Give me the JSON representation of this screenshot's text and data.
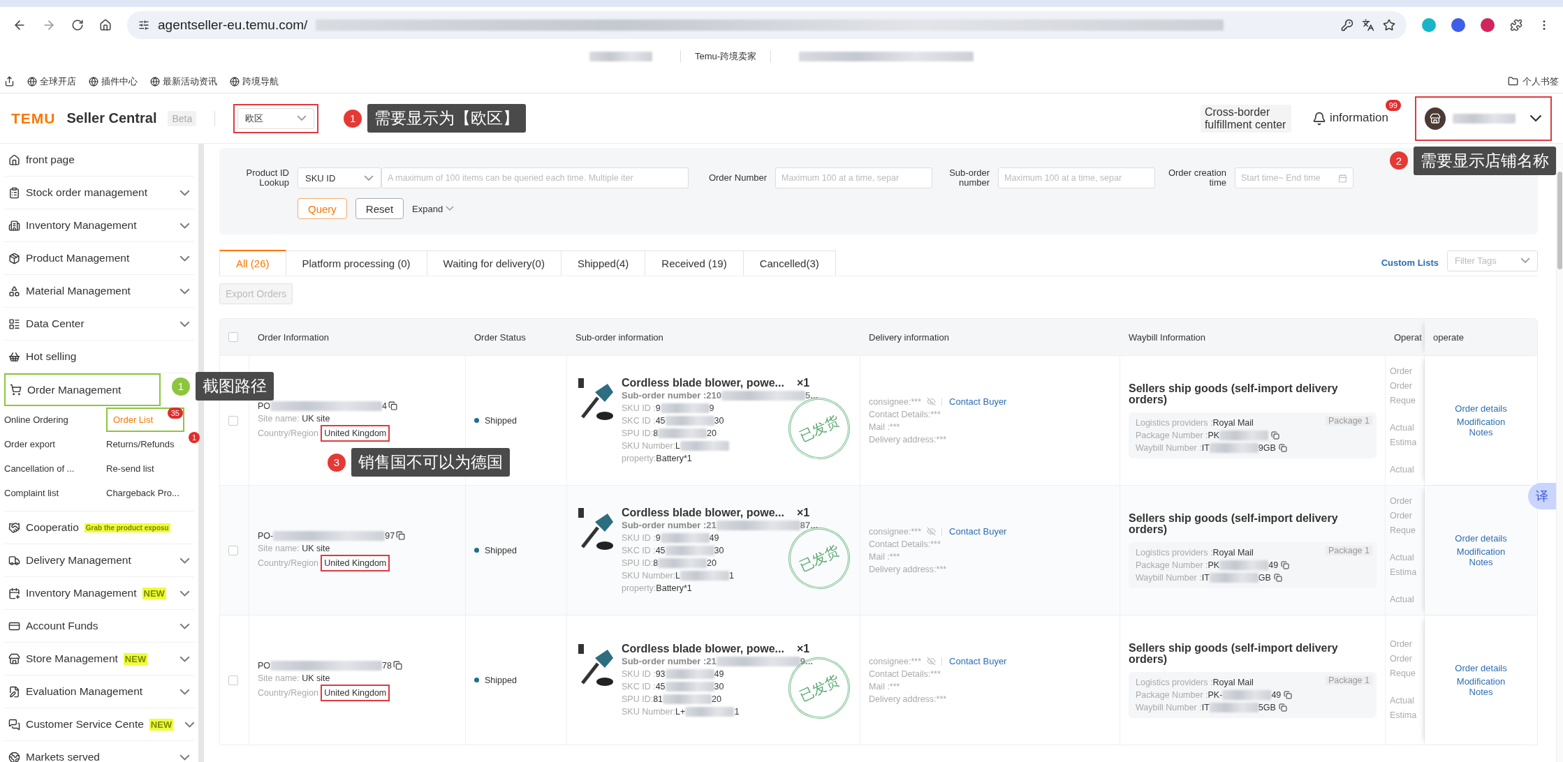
{
  "browser": {
    "url": "agentseller-eu.temu.com/",
    "tab_title": "Temu-跨境卖家",
    "bookmarks": [
      "全球开店",
      "插件中心",
      "最新活动资讯",
      "跨境导航"
    ],
    "bookmark_folder": "个人书签"
  },
  "header": {
    "brand": "TEMU",
    "product": "Seller Central",
    "beta": "Beta",
    "region": {
      "value": "欧区",
      "color": "#e0393e",
      "callout": {
        "number": "1",
        "text": "需要显示为【欧区】",
        "color": "#e53935"
      }
    },
    "fulfillment": "Cross-border fulfillment center",
    "information": {
      "label": "information",
      "badge": "99"
    },
    "account": {
      "color": "#e0393e",
      "callout": {
        "number": "2",
        "text": "需要显示店铺名称",
        "color": "#e53935"
      }
    }
  },
  "sidebar": {
    "items": [
      {
        "label": "front page",
        "kind": "link"
      },
      {
        "label": "Stock order management",
        "kind": "group"
      },
      {
        "label": "Inventory Management",
        "kind": "group"
      },
      {
        "label": "Product Management",
        "kind": "group"
      },
      {
        "label": "Material Management",
        "kind": "group"
      },
      {
        "label": "Data Center",
        "kind": "group"
      },
      {
        "label": "Hot selling",
        "kind": "link"
      },
      {
        "label": "Order Management",
        "kind": "open",
        "color": "#8cc63f",
        "callout": {
          "number": "1",
          "text": "截图路径",
          "color": "#8cc63f"
        },
        "children": [
          {
            "label": "Online Ordering",
            "selected": false
          },
          {
            "label": "Order List",
            "selected": true,
            "badge": "35",
            "color": "#8cc63f"
          },
          {
            "label": "Order export",
            "selected": false
          },
          {
            "label": "Returns/Refunds",
            "selected": false,
            "badge": "1"
          },
          {
            "label": "Cancellation of ...",
            "selected": false
          },
          {
            "label": "Re-send list",
            "selected": false
          },
          {
            "label": "Complaint list",
            "selected": false
          },
          {
            "label": "Chargeback Pro...",
            "selected": false
          }
        ]
      },
      {
        "label": "Cooperatio",
        "kind": "promo",
        "tag": "Grab the product exposu"
      },
      {
        "label": "Delivery Management",
        "kind": "group"
      },
      {
        "label": "Inventory Management",
        "kind": "group",
        "tag": "NEW"
      },
      {
        "label": "Account Funds",
        "kind": "group"
      },
      {
        "label": "Store Management",
        "kind": "group",
        "tag": "NEW"
      },
      {
        "label": "Evaluation Management",
        "kind": "group"
      },
      {
        "label": "Customer Service Cente",
        "kind": "group",
        "tag": "NEW"
      },
      {
        "label": "Markets served",
        "kind": "group"
      }
    ]
  },
  "filters": {
    "lookup_label": "Product ID Lookup",
    "lookup_type": "SKU ID",
    "lookup_placeholder": "A maximum of 100 items can be queried each time. Multiple iter",
    "order_label": "Order Number",
    "order_placeholder": "Maximum 100 at a time, separ",
    "suborder_label": "Sub-order number",
    "suborder_placeholder": "Maximum 100 at a time, separ",
    "time_label": "Order creation time",
    "time_placeholder": "Start time~ End time",
    "query": "Query",
    "reset": "Reset",
    "expand": "Expand"
  },
  "tabs": [
    {
      "label": "All (26)",
      "selected": true
    },
    {
      "label": "Platform processing (0)",
      "selected": false
    },
    {
      "label": "Waiting for delivery(0)",
      "selected": false
    },
    {
      "label": "Shipped(4)",
      "selected": false
    },
    {
      "label": "Received (19)",
      "selected": false
    },
    {
      "label": "Cancelled(3)",
      "selected": false
    }
  ],
  "custom_lists": "Custom Lists",
  "filter_tags": "Filter Tags",
  "export": {
    "label": "Export Orders",
    "disabled": true
  },
  "table": {
    "checked": false,
    "columns": [
      "Order Information",
      "Order Status",
      "Sub-order information",
      "Delivery information",
      "Waybill Information",
      "Operat",
      "operate"
    ],
    "rows": [
      {
        "checked": false,
        "order_no": {
          "head": "PO",
          "tail": "4"
        },
        "site_label": "Site name:",
        "site": "UK site",
        "country_label": "Country/Region",
        "country": {
          "name": "United Kingdom",
          "color": "#e0393e"
        },
        "callout": {
          "number": "3",
          "text": "销售国不可以为德国",
          "color": "#e53935"
        },
        "status": "Shipped",
        "product": {
          "title": "Cordless blade blower, powe...",
          "qty": "×1",
          "sub_order": {
            "label": "Sub-order number :",
            "head": "210",
            "tail": "5..."
          },
          "fields": [
            {
              "label": "SKU ID :",
              "head": "9",
              "tail": "9"
            },
            {
              "label": "SKC ID :",
              "head": "45",
              "tail": "30"
            },
            {
              "label": "SPU ID:",
              "head": "8",
              "tail": "20"
            },
            {
              "label": "SKU Number:",
              "head": "L"
            }
          ],
          "property_label": "property:",
          "property": "Battery*1",
          "stamp": "已发货"
        },
        "delivery": {
          "consignee": "consignee:***",
          "contact": "Contact Buyer",
          "details": [
            "Contact Details:***",
            "Mail :***",
            "Delivery address:***"
          ]
        },
        "waybill": {
          "title": "Sellers ship goods (self-import delivery orders)",
          "provider_label": "Logistics providers :",
          "provider": "Royal Mail",
          "package": "Package 1",
          "package_no": {
            "label": "Package Number :",
            "head": "PK"
          },
          "waybill_no": {
            "label": "Waybill Number :",
            "head": "IT",
            "tail": "9GB"
          }
        },
        "operat": [
          "Order",
          "Order",
          "Reque",
          "Actual",
          "Estima",
          "Actual"
        ],
        "actions": [
          "Order details",
          "Modification Notes"
        ]
      },
      {
        "checked": false,
        "order_no": {
          "head": "PO-",
          "tail": "97"
        },
        "site_label": "Site name:",
        "site": "UK site",
        "country_label": "Country/Region",
        "country": {
          "name": "United Kingdom",
          "color": "#e0393e"
        },
        "status": "Shipped",
        "product": {
          "title": "Cordless blade blower, powe...",
          "qty": "×1",
          "sub_order": {
            "label": "Sub-order number :",
            "head": "21",
            "tail": "87..."
          },
          "fields": [
            {
              "label": "SKU ID :",
              "head": "9",
              "tail": "49"
            },
            {
              "label": "SKC ID :",
              "head": "45",
              "tail": "30"
            },
            {
              "label": "SPU ID:",
              "head": "8",
              "tail": "20"
            },
            {
              "label": "SKU Number:",
              "head": "L",
              "tail": "1"
            }
          ],
          "property_label": "property:",
          "property": "Battery*1",
          "stamp": "已发货"
        },
        "delivery": {
          "consignee": "consignee:***",
          "contact": "Contact Buyer",
          "details": [
            "Contact Details:***",
            "Mail :***",
            "Delivery address:***"
          ]
        },
        "waybill": {
          "title": "Sellers ship goods (self-import delivery orders)",
          "provider_label": "Logistics providers :",
          "provider": "Royal Mail",
          "package": "Package 1",
          "package_no": {
            "label": "Package Number :",
            "head": "PK",
            "tail": "49"
          },
          "waybill_no": {
            "label": "Waybill Number :",
            "head": "IT",
            "tail": "GB"
          }
        },
        "operat": [
          "Order",
          "Order",
          "Reque",
          "Actual",
          "Estima",
          "Actual"
        ],
        "actions": [
          "Order details",
          "Modification Notes"
        ]
      },
      {
        "checked": false,
        "order_no": {
          "head": "PO",
          "tail": "78"
        },
        "site_label": "Site name:",
        "site": "UK site",
        "country_label": "Country/Region",
        "country": {
          "name": "United Kingdom",
          "color": "#e0393e"
        },
        "status": "Shipped",
        "product": {
          "title": "Cordless blade blower, powe...",
          "qty": "×1",
          "sub_order": {
            "label": "Sub-order number :",
            "head": "21",
            "tail": "9..."
          },
          "fields": [
            {
              "label": "SKU ID :",
              "head": "93",
              "tail": "49"
            },
            {
              "label": "SKC ID :",
              "head": "45",
              "tail": "30"
            },
            {
              "label": "SPU ID:",
              "head": "81",
              "tail": "20"
            },
            {
              "label": "SKU Number:",
              "head": "L+",
              "tail": "1"
            }
          ],
          "stamp": "已发货"
        },
        "delivery": {
          "consignee": "consignee:***",
          "contact": "Contact Buyer",
          "details": [
            "Contact Details:***",
            "Mail :***",
            "Delivery address:***"
          ]
        },
        "waybill": {
          "title": "Sellers ship goods (self-import delivery orders)",
          "provider_label": "Logistics providers :",
          "provider": "Royal Mail",
          "package": "Package 1",
          "package_no": {
            "label": "Package Number :",
            "head": "PK-",
            "tail": "49"
          },
          "waybill_no": {
            "label": "Waybill Number :",
            "head": "IT",
            "tail": "5GB"
          }
        },
        "operat": [
          "Order",
          "Order",
          "Reque",
          "Actual",
          "Estima"
        ],
        "actions": [
          "Order details",
          "Modification Notes"
        ]
      }
    ]
  },
  "translate_button": "译"
}
